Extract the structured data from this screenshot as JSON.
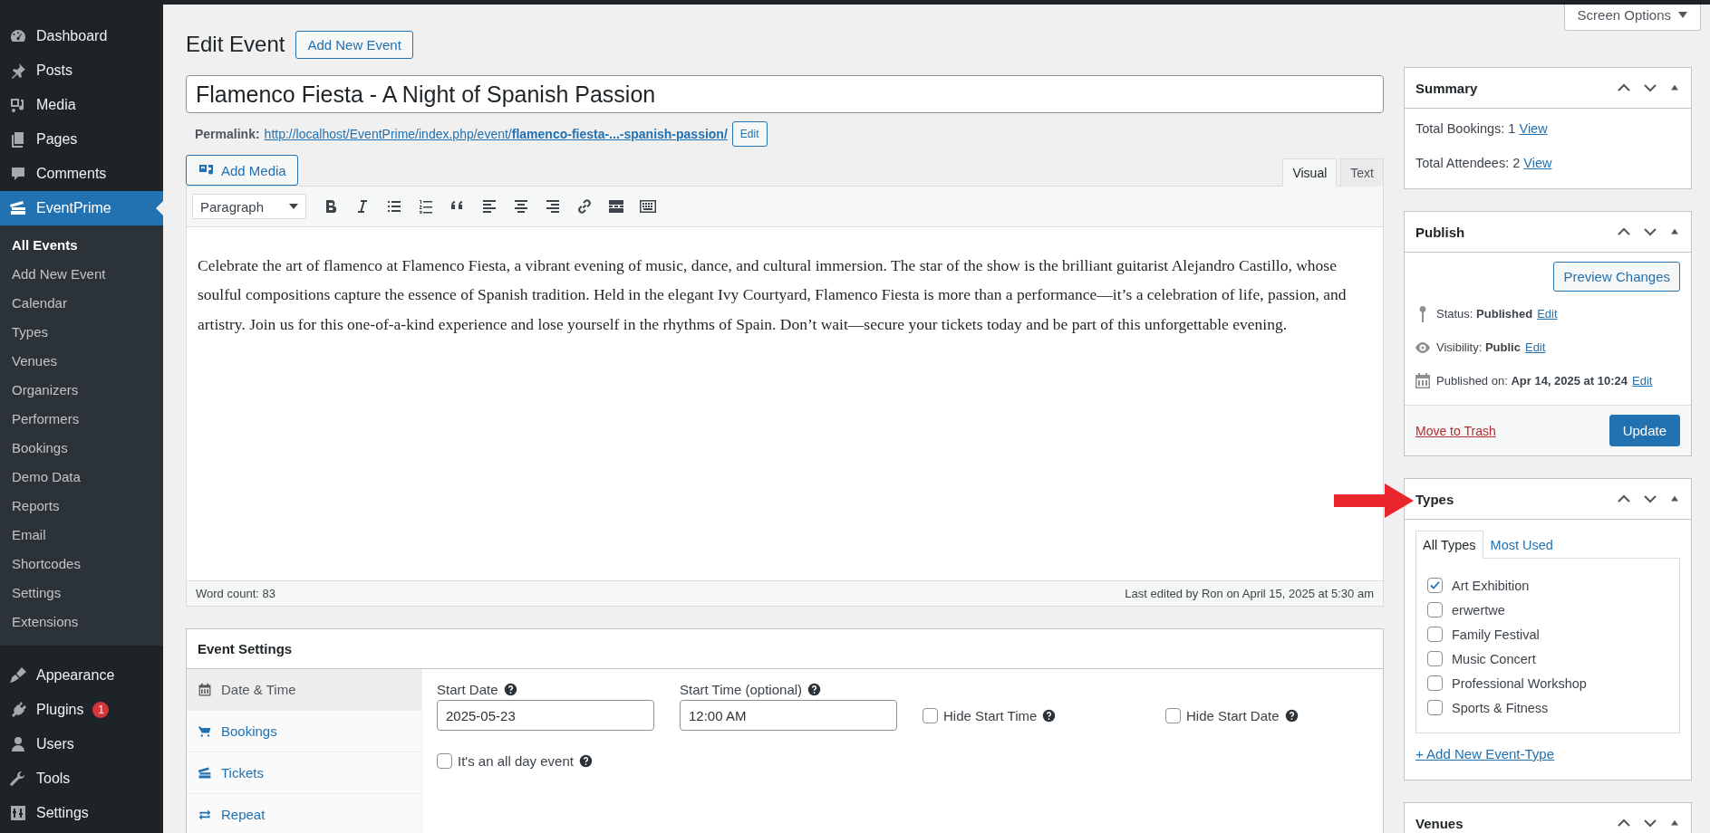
{
  "sidebar": {
    "items": [
      {
        "label": "Dashboard",
        "selected": false
      },
      {
        "label": "Posts",
        "selected": false
      },
      {
        "label": "Media",
        "selected": false
      },
      {
        "label": "Pages",
        "selected": false
      },
      {
        "label": "Comments",
        "selected": false
      },
      {
        "label": "EventPrime",
        "selected": true
      },
      {
        "label": "Appearance",
        "selected": false
      },
      {
        "label": "Plugins",
        "selected": false,
        "badge": "1"
      },
      {
        "label": "Users",
        "selected": false
      },
      {
        "label": "Tools",
        "selected": false
      },
      {
        "label": "Settings",
        "selected": false
      }
    ],
    "submenu": [
      {
        "label": "All Events",
        "selected": true
      },
      {
        "label": "Add New Event",
        "selected": false
      },
      {
        "label": "Calendar",
        "selected": false
      },
      {
        "label": "Types",
        "selected": false
      },
      {
        "label": "Venues",
        "selected": false
      },
      {
        "label": "Organizers",
        "selected": false
      },
      {
        "label": "Performers",
        "selected": false
      },
      {
        "label": "Bookings",
        "selected": false
      },
      {
        "label": "Demo Data",
        "selected": false
      },
      {
        "label": "Reports",
        "selected": false
      },
      {
        "label": "Email",
        "selected": false
      },
      {
        "label": "Shortcodes",
        "selected": false
      },
      {
        "label": "Settings",
        "selected": false
      },
      {
        "label": "Extensions",
        "selected": false
      }
    ]
  },
  "header": {
    "title": "Edit Event",
    "add_new_button": "Add New Event",
    "screen_options": "Screen Options"
  },
  "post": {
    "title": "Flamenco Fiesta - A Night of Spanish Passion",
    "permalink_label": "Permalink:",
    "permalink_url": "http://localhost/EventPrime/index.php/event/**flamenco-fiesta-...-spanish-passion/**",
    "permalink_edit": "Edit"
  },
  "editor": {
    "add_media": "Add Media",
    "tabs": [
      {
        "label": "Visual",
        "selected": true
      },
      {
        "label": "Text",
        "selected": false
      }
    ],
    "format": "Paragraph",
    "content": "Celebrate the art of flamenco at Flamenco Fiesta, a vibrant evening of music, dance, and cultural immersion. The star of the show is the brilliant guitarist Alejandro Castillo, whose soulful compositions capture the essence of Spanish tradition. Held in the elegant Ivy Courtyard, Flamenco Fiesta is more than a performance—it’s a celebration of life, passion, and artistry. Join us for this one-of-a-kind experience and lose yourself in the rhythms of Spain. Don’t wait—secure your tickets today and be part of this unforgettable evening.",
    "word_count": "Word count: 83",
    "last_edited": "Last edited by Ron on April 15, 2025 at 5:30 am"
  },
  "event_settings": {
    "title": "Event Settings",
    "tabs": [
      {
        "label": "Date & Time",
        "selected": true
      },
      {
        "label": "Bookings",
        "selected": false
      },
      {
        "label": "Tickets",
        "selected": false
      },
      {
        "label": "Repeat",
        "selected": false
      }
    ],
    "start_date": {
      "label": "Start Date",
      "value": "2025-05-23"
    },
    "start_time": {
      "label": "Start Time (optional)",
      "value": "12:00 AM"
    },
    "options": [
      {
        "label": "Hide Start Time",
        "checked": false
      },
      {
        "label": "Hide Start Date",
        "checked": false
      },
      {
        "label": "It's an all day event",
        "checked": false
      }
    ]
  },
  "summary": {
    "title": "Summary",
    "lines": [
      {
        "label": "Total Bookings: 1",
        "link": "View"
      },
      {
        "label": "Total Attendees: 2",
        "link": "View"
      }
    ]
  },
  "publish": {
    "title": "Publish",
    "preview_button": "Preview Changes",
    "rows": [
      {
        "label": "Status:",
        "value": "Published",
        "link": "Edit"
      },
      {
        "label": "Visibility:",
        "value": "Public",
        "link": "Edit"
      },
      {
        "label": "Published on:",
        "value": "Apr 14, 2025 at 10:24",
        "link": "Edit"
      }
    ],
    "trash_link": "Move to Trash",
    "update_button": "Update"
  },
  "types": {
    "title": "Types",
    "tabs": [
      {
        "label": "All Types",
        "selected": true
      },
      {
        "label": "Most Used",
        "selected": false
      }
    ],
    "items": [
      {
        "label": "Art Exhibition",
        "checked": true
      },
      {
        "label": "erwertwe",
        "checked": false
      },
      {
        "label": "Family Festival",
        "checked": false
      },
      {
        "label": "Music Concert",
        "checked": false
      },
      {
        "label": "Professional Workshop",
        "checked": false
      },
      {
        "label": "Sports & Fitness",
        "checked": false
      }
    ],
    "add_link": "+ Add New Event-Type"
  },
  "venues": {
    "title": "Venues"
  }
}
